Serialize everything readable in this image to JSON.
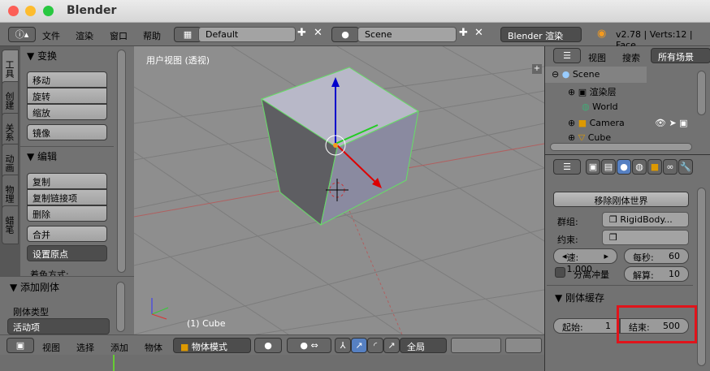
{
  "window": {
    "title": "Blender"
  },
  "topbar": {
    "menus": [
      "文件",
      "渲染",
      "窗口",
      "帮助"
    ],
    "layout": "Default",
    "scene": "Scene",
    "engine": "Blender 渲染",
    "stats": "v2.78 | Verts:12 | Face"
  },
  "left_tabs": [
    "工具",
    "创建",
    "关系",
    "动画",
    "物理",
    "蜡笔"
  ],
  "tool_panel": {
    "transform_title": "变换",
    "transform_buttons": [
      "移动",
      "旋转",
      "缩放"
    ],
    "mirror": "镜像",
    "edit_title": "编辑",
    "edit_buttons": [
      "复制",
      "复制链接项",
      "删除"
    ],
    "join": "合并",
    "set_origin": "设置原点",
    "shading_partial": "着色方式:"
  },
  "rigidbody_panel": {
    "title": "添加刚体",
    "type_label": "刚体类型",
    "type_value": "活动项"
  },
  "viewport": {
    "label": "用户视图 (透视)",
    "object": "(1) Cube"
  },
  "bottombar": {
    "menus": [
      "视图",
      "选择",
      "添加",
      "物体"
    ],
    "mode": "物体模式",
    "orientation": "全局"
  },
  "outliner": {
    "menus": [
      "视图",
      "搜索"
    ],
    "filter": "所有场景",
    "items": [
      "Scene",
      "渲染层",
      "World",
      "Camera",
      "Cube"
    ]
  },
  "properties": {
    "remove_world": "移除刚体世界",
    "group_label": "群组:",
    "group_value": "RigidBody...",
    "constraint_label": "约束:",
    "speed": "速: 1.000",
    "fps_label": "每秒:",
    "fps_value": "60",
    "split_impulse": "分离冲量",
    "solver_label": "解算:",
    "solver_value": "10",
    "cache_title": "刚体缓存",
    "start_label": "起始:",
    "start_value": "1",
    "end_label": "结束:",
    "end_value": "500"
  },
  "colors": {
    "highlight_box": "#e0141b",
    "accent_blue": "#5680c2",
    "selection_outline": "#66dd66"
  }
}
